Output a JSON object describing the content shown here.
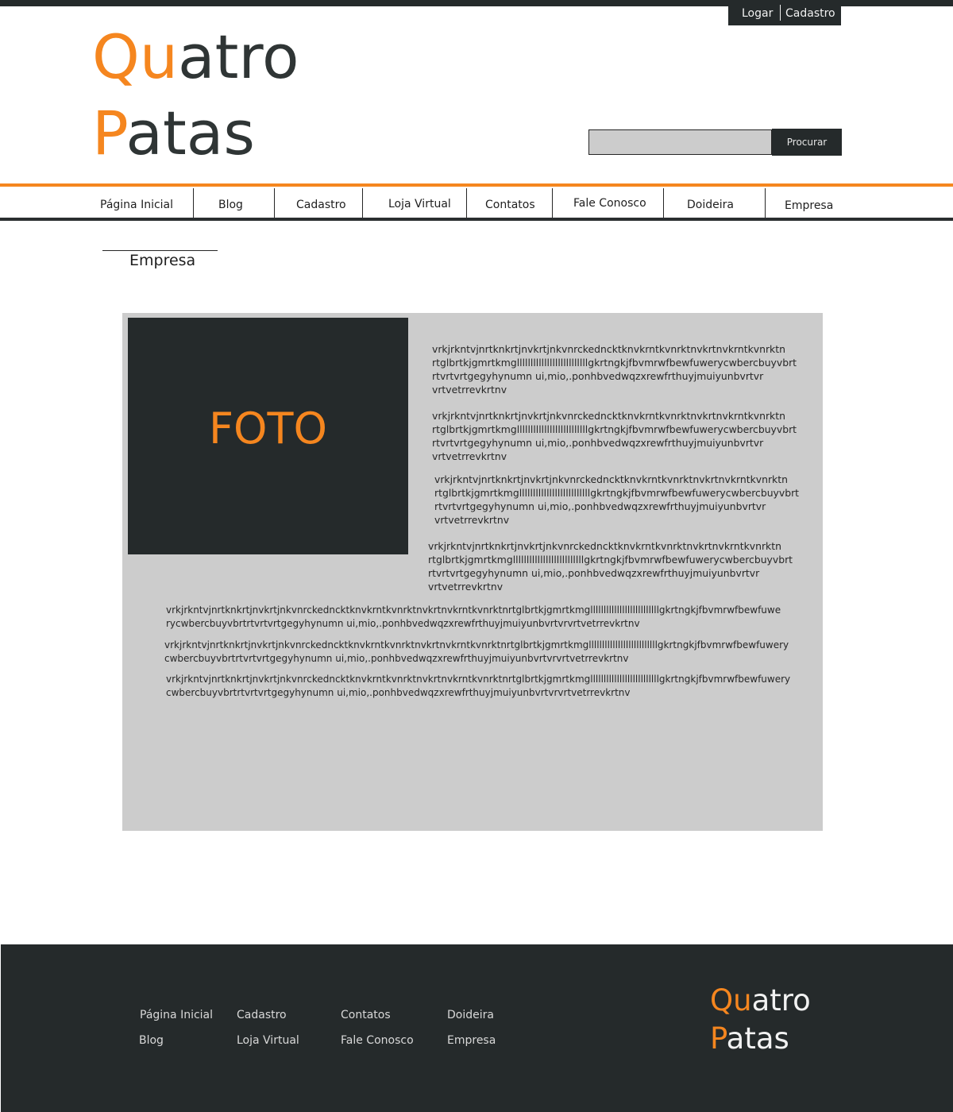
{
  "header": {
    "auth": {
      "login": "Logar",
      "signup": "Cadastro"
    },
    "logo": {
      "line1_accent": "Qu",
      "line1_rest": "atro",
      "line2_accent": "P",
      "line2_rest": "atas"
    },
    "search": {
      "button": "Procurar",
      "value": ""
    }
  },
  "nav": {
    "items": [
      {
        "label": "Página Inicial"
      },
      {
        "label": "Blog"
      },
      {
        "label": "Cadastro"
      },
      {
        "label": "Loja Virtual"
      },
      {
        "label": "Contatos"
      },
      {
        "label": "Fale Conosco"
      },
      {
        "label": "Doideira"
      },
      {
        "label": "Empresa"
      }
    ]
  },
  "page": {
    "breadcrumb": "Empresa",
    "photo_label": "FOTO",
    "side_paragraphs": [
      {
        "lines": [
          "vrkjrkntvjnrtknkrtjnvkrtjnkvnrckedncktknvkrntkvnrktnvkrtnvkrntkvnrktn",
          "rtglbrtkjgmrtkmgllllllllllllllllllllllllllgkrtngkjfbvmrwfbewfuwerycwbercbuyvbrt",
          "rtvrtvrtgegyhynumn ui,mio,.ponhbvedwqzxrewfrthuyjmuiyunbvrtvr",
          "vrtvetrrevkrtnv"
        ]
      },
      {
        "lines": [
          "vrkjrkntvjnrtknkrtjnvkrtjnkvnrckedncktknvkrntkvnrktnvkrtnvkrntkvnrktn",
          "rtglbrtkjgmrtkmgllllllllllllllllllllllllllgkrtngkjfbvmrwfbewfuwerycwbercbuyvbrt",
          "rtvrtvrtgegyhynumn ui,mio,.ponhbvedwqzxrewfrthuyjmuiyunbvrtvr",
          "vrtvetrrevkrtnv"
        ]
      },
      {
        "lines": [
          "vrkjrkntvjnrtknkrtjnvkrtjnkvnrckedncktknvkrntkvnrktnvkrtnvkrntkvnrktn",
          "rtglbrtkjgmrtkmgllllllllllllllllllllllllllgkrtngkjfbvmrwfbewfuwerycwbercbuyvbrt",
          "rtvrtvrtgegyhynumn ui,mio,.ponhbvedwqzxrewfrthuyjmuiyunbvrtvr",
          "vrtvetrrevkrtnv"
        ]
      },
      {
        "lines": [
          "vrkjrkntvjnrtknkrtjnvkrtjnkvnrckedncktknvkrntkvnrktnvkrtnvkrntkvnrktn",
          "rtglbrtkjgmrtkmgllllllllllllllllllllllllllgkrtngkjfbvmrwfbewfuwerycwbercbuyvbrt",
          "rtvrtvrtgegyhynumn ui,mio,.ponhbvedwqzxrewfrthuyjmuiyunbvrtvr",
          "vrtvetrrevkrtnv"
        ]
      }
    ],
    "wide_paragraphs": [
      {
        "lines": [
          "vrkjrkntvjnrtknkrtjnvkrtjnkvnrckedncktknvkrntkvnrktnvkrtnvkrntkvnrktnrtglbrtkjgmrtkmgllllllllllllllllllllllllllgkrtngkjfbvmrwfbewfuwe",
          "rycwbercbuyvbrtrtvrtvrtgegyhynumn ui,mio,.ponhbvedwqzxrewfrthuyjmuiyunbvrtvrvrtvetrrevkrtnv"
        ]
      },
      {
        "lines": [
          "vrkjrkntvjnrtknkrtjnvkrtjnkvnrckedncktknvkrntkvnrktnvkrtnvkrntkvnrktnrtglbrtkjgmrtkmgllllllllllllllllllllllllllgkrtngkjfbvmrwfbewfuwery",
          "cwbercbuyvbrtrtvrtvrtgegyhynumn ui,mio,.ponhbvedwqzxrewfrthuyjmuiyunbvrtvrvrtvetrrevkrtnv"
        ]
      },
      {
        "lines": [
          "vrkjrkntvjnrtknkrtjnvkrtjnkvnrckedncktknvkrntkvnrktnvkrtnvkrntkvnrktnrtglbrtkjgmrtkmgllllllllllllllllllllllllllgkrtngkjfbvmrwfbewfuwery",
          "cwbercbuyvbrtrtvrtvrtgegyhynumn ui,mio,.ponhbvedwqzxrewfrthuyjmuiyunbvrtvrvrtvetrrevkrtnv"
        ]
      }
    ]
  },
  "footer": {
    "links": {
      "col1": [
        "Página Inicial",
        "Blog"
      ],
      "col2": [
        "Cadastro",
        "Loja Virtual"
      ],
      "col3": [
        "Contatos",
        "Fale Conosco"
      ],
      "col4": [
        "Doideira",
        "Empresa"
      ]
    },
    "logo": {
      "line1_accent": "Qu",
      "line1_rest": "atro",
      "line2_accent": "P",
      "line2_rest": "atas"
    }
  },
  "colors": {
    "accent": "#f5861f",
    "dark": "#252a2b",
    "panel": "#cccccc"
  }
}
